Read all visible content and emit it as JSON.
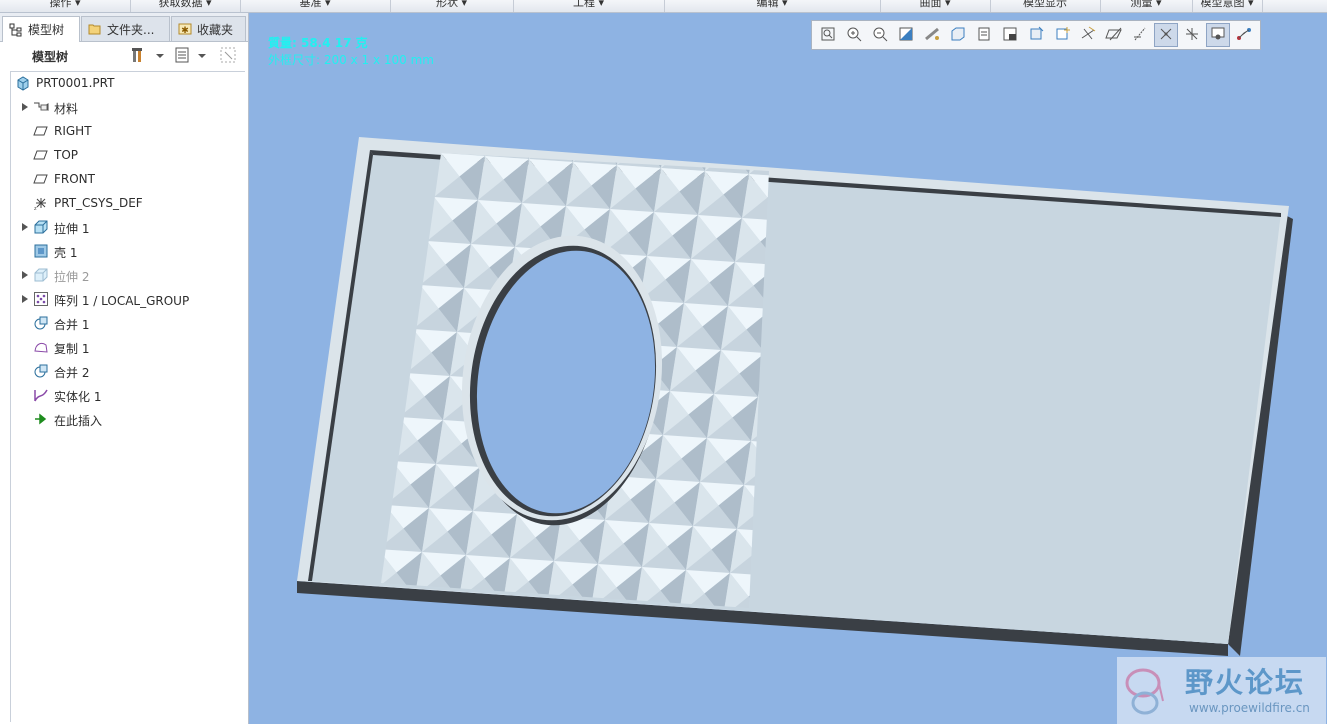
{
  "ribbon": {
    "groups": [
      {
        "label": "操作 ▾"
      },
      {
        "label": "获取数据 ▾"
      },
      {
        "label": "基准 ▾"
      },
      {
        "label": "形状 ▾"
      },
      {
        "label": "工程 ▾"
      },
      {
        "label": "编辑 ▾"
      },
      {
        "label": "曲面 ▾"
      },
      {
        "label": "模型显示"
      },
      {
        "label": "测量 ▾"
      },
      {
        "label": "模型意图 ▾"
      }
    ]
  },
  "left_panel": {
    "tabs": [
      {
        "label": "模型树",
        "icon": "tree-icon"
      },
      {
        "label": "文件夹...",
        "icon": "folder-icon"
      },
      {
        "label": "收藏夹",
        "icon": "favorites-icon"
      }
    ],
    "toolbar_title": "模型树",
    "tree": [
      {
        "label": "PRT0001.PRT",
        "icon": "part-icon",
        "expandable": false,
        "dimmed": false,
        "level": 0
      },
      {
        "label": "材料",
        "icon": "material-icon",
        "expandable": true,
        "dimmed": false,
        "level": 1
      },
      {
        "label": "RIGHT",
        "icon": "datum-plane-icon",
        "expandable": false,
        "dimmed": false,
        "level": 1
      },
      {
        "label": "TOP",
        "icon": "datum-plane-icon",
        "expandable": false,
        "dimmed": false,
        "level": 1
      },
      {
        "label": "FRONT",
        "icon": "datum-plane-icon",
        "expandable": false,
        "dimmed": false,
        "level": 1
      },
      {
        "label": "PRT_CSYS_DEF",
        "icon": "csys-icon",
        "expandable": false,
        "dimmed": false,
        "level": 1
      },
      {
        "label": "拉伸 1",
        "icon": "extrude-icon",
        "expandable": true,
        "dimmed": false,
        "level": 1
      },
      {
        "label": "壳 1",
        "icon": "shell-icon",
        "expandable": false,
        "dimmed": false,
        "level": 1
      },
      {
        "label": "拉伸 2",
        "icon": "extrude-icon",
        "expandable": true,
        "dimmed": true,
        "level": 1
      },
      {
        "label": "阵列 1 / LOCAL_GROUP",
        "icon": "pattern-icon",
        "expandable": true,
        "dimmed": false,
        "level": 1
      },
      {
        "label": "合并 1",
        "icon": "merge-icon",
        "expandable": false,
        "dimmed": false,
        "level": 1
      },
      {
        "label": "复制 1",
        "icon": "copy-icon",
        "expandable": false,
        "dimmed": false,
        "level": 1
      },
      {
        "label": "合并 2",
        "icon": "merge-icon",
        "expandable": false,
        "dimmed": false,
        "level": 1
      },
      {
        "label": "实体化 1",
        "icon": "solidify-icon",
        "expandable": false,
        "dimmed": false,
        "level": 1
      },
      {
        "label": "在此插入",
        "icon": "insert-here-icon",
        "expandable": false,
        "dimmed": false,
        "level": 1
      }
    ]
  },
  "viewport": {
    "info_line1": "質量: 58.4 17 克",
    "info_line2": "外框尺寸: 200 x 1 x 100 mm",
    "tools": [
      {
        "icon": "refit-icon",
        "active": false
      },
      {
        "icon": "zoom-in-icon",
        "active": false
      },
      {
        "icon": "zoom-out-icon",
        "active": false
      },
      {
        "icon": "repaint-icon",
        "active": false
      },
      {
        "icon": "perspective-icon",
        "active": false
      },
      {
        "icon": "display-style-icon",
        "active": false
      },
      {
        "icon": "saved-views-icon",
        "active": false
      },
      {
        "icon": "view-manager-icon",
        "active": false
      },
      {
        "icon": "section-icon",
        "active": false
      },
      {
        "icon": "spin-center-icon",
        "active": false
      },
      {
        "icon": "datum-display-icon",
        "active": false
      },
      {
        "icon": "plane-display-icon",
        "active": false
      },
      {
        "icon": "axis-display-icon",
        "active": false
      },
      {
        "icon": "point-display-icon",
        "active": true
      },
      {
        "icon": "csys-display-icon",
        "active": false
      },
      {
        "icon": "annotation-display-icon",
        "active": true
      },
      {
        "icon": "appearance-icon",
        "active": false
      }
    ],
    "colors": {
      "background": "#8eb3e3",
      "info_text": "#22f0f0",
      "plate_face": "#c8d6e0",
      "plate_edge": "#3a3f45"
    }
  },
  "watermark": {
    "title": "野火论坛",
    "url": "www.proewildfire.cn"
  }
}
